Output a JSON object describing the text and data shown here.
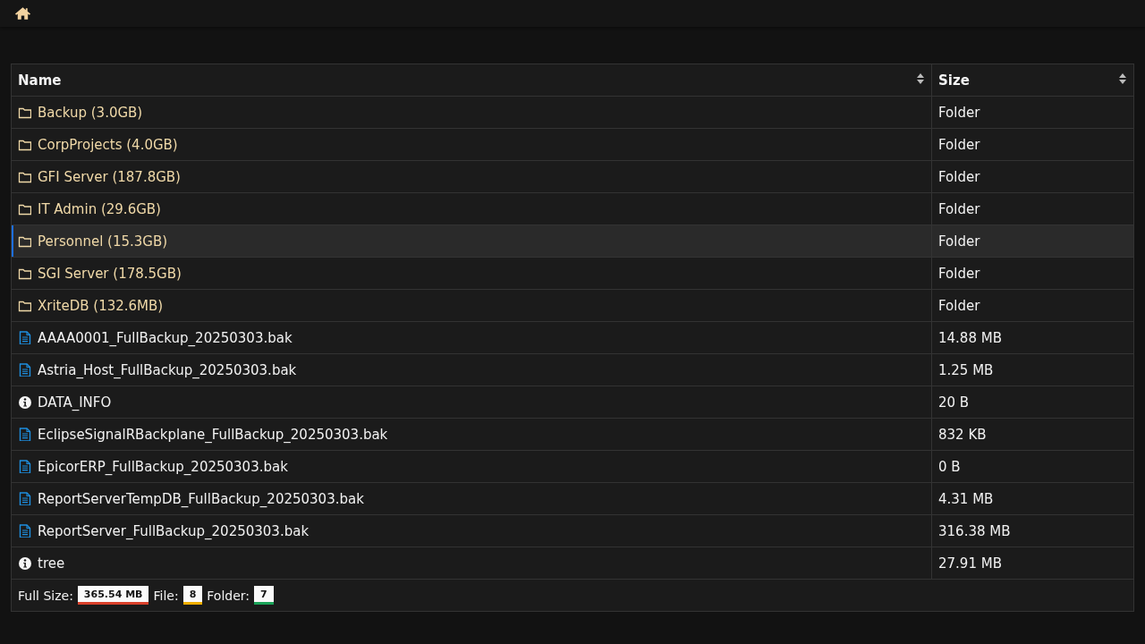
{
  "table": {
    "columns": [
      {
        "label": "Name"
      },
      {
        "label": "Size"
      }
    ],
    "rows": [
      {
        "kind": "folder",
        "name": "Backup (3.0GB)",
        "size": "Folder",
        "selected": false
      },
      {
        "kind": "folder",
        "name": "CorpProjects (4.0GB)",
        "size": "Folder",
        "selected": false
      },
      {
        "kind": "folder",
        "name": "GFI Server (187.8GB)",
        "size": "Folder",
        "selected": false
      },
      {
        "kind": "folder",
        "name": "IT Admin (29.6GB)",
        "size": "Folder",
        "selected": false
      },
      {
        "kind": "folder",
        "name": "Personnel (15.3GB)",
        "size": "Folder",
        "selected": true
      },
      {
        "kind": "folder",
        "name": "SGI Server (178.5GB)",
        "size": "Folder",
        "selected": false
      },
      {
        "kind": "folder",
        "name": "XriteDB (132.6MB)",
        "size": "Folder",
        "selected": false
      },
      {
        "kind": "file",
        "name": "AAAA0001_FullBackup_20250303.bak",
        "size": "14.88 MB",
        "selected": false
      },
      {
        "kind": "file",
        "name": "Astria_Host_FullBackup_20250303.bak",
        "size": "1.25 MB",
        "selected": false
      },
      {
        "kind": "info",
        "name": "DATA_INFO",
        "size": "20 B",
        "selected": false
      },
      {
        "kind": "file",
        "name": "EclipseSignalRBackplane_FullBackup_20250303.bak",
        "size": "832 KB",
        "selected": false
      },
      {
        "kind": "file",
        "name": "EpicorERP_FullBackup_20250303.bak",
        "size": "0 B",
        "selected": false
      },
      {
        "kind": "file",
        "name": "ReportServerTempDB_FullBackup_20250303.bak",
        "size": "4.31 MB",
        "selected": false
      },
      {
        "kind": "file",
        "name": "ReportServer_FullBackup_20250303.bak",
        "size": "316.38 MB",
        "selected": false
      },
      {
        "kind": "info",
        "name": "tree",
        "size": "27.91 MB",
        "selected": false
      }
    ]
  },
  "footer": [
    {
      "label": "Full Size:",
      "value": "365.54 MB",
      "color": "#d9412b"
    },
    {
      "label": "File:",
      "value": "8",
      "color": "#f0ad00"
    },
    {
      "label": "Folder:",
      "value": "7",
      "color": "#1aa358"
    }
  ]
}
